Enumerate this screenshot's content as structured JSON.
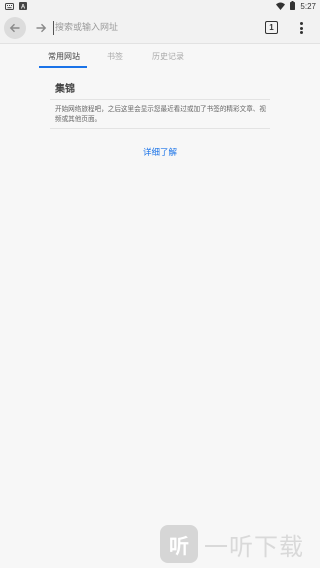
{
  "status_bar": {
    "time": "5:27",
    "icons": [
      "keyboard-icon",
      "notification-a-icon",
      "wifi-icon",
      "battery-icon"
    ]
  },
  "toolbar": {
    "url_placeholder": "搜索或输入网址",
    "tab_count": "1"
  },
  "tabs": [
    {
      "label": "常用网站",
      "active": true
    },
    {
      "label": "书签",
      "active": false
    },
    {
      "label": "历史记录",
      "active": false
    }
  ],
  "card": {
    "title": "集锦",
    "description": "开始网络旅程吧，之后这里会显示您最近看过或加了书签的精彩文章、视频或其他页面。"
  },
  "learn_more": "详细了解",
  "watermark": {
    "logo_glyph": "听",
    "text": "一听下载"
  },
  "colors": {
    "accent": "#1a73e8",
    "background": "#f7f7f7",
    "toolbar": "#f2f2f2"
  }
}
